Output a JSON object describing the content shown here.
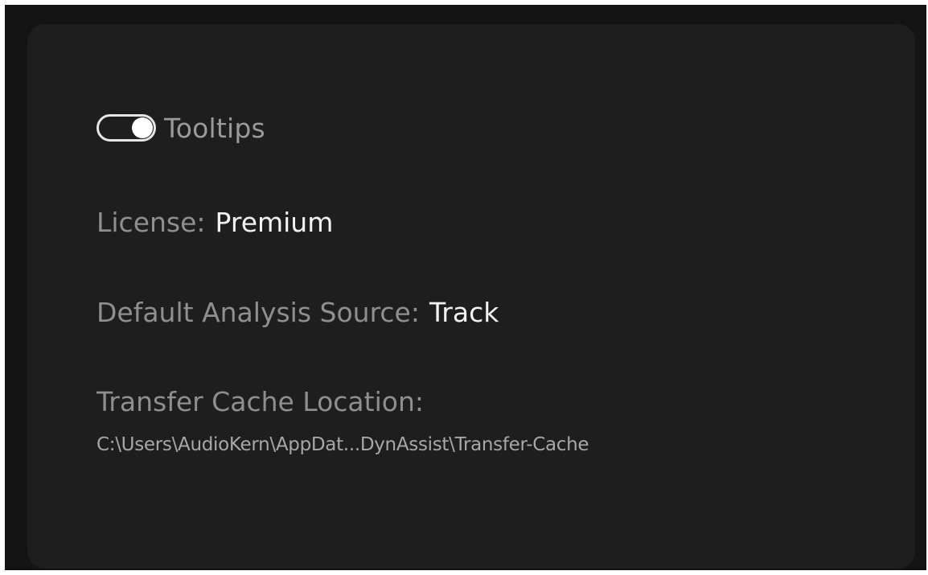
{
  "settings": {
    "tooltips": {
      "label": "Tooltips",
      "enabled": true
    },
    "license": {
      "label": "License:",
      "value": "Premium"
    },
    "analysis_source": {
      "label": "Default Analysis Source:",
      "value": "Track"
    },
    "cache_location": {
      "label": "Transfer Cache Location:",
      "path": "C:\\Users\\AudioKern\\AppDat...DynAssist\\Transfer-Cache"
    }
  },
  "colors": {
    "background": "#141414",
    "panel": "#1e1e1e",
    "label_text": "#8f8f8f",
    "value_text": "#f2f2f2",
    "toggle_on": "#ffffff"
  },
  "icons": {
    "toggle": "toggle-switch-icon"
  }
}
